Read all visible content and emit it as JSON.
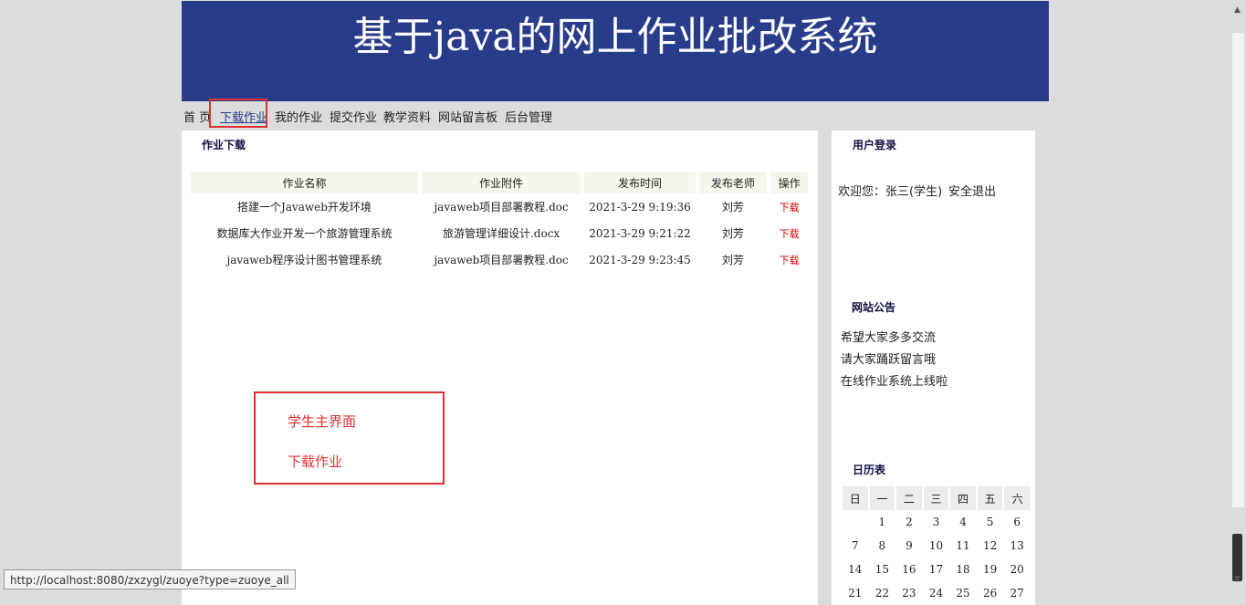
{
  "site": {
    "title": "基于java的网上作业批改系统"
  },
  "nav": {
    "items": [
      "首 页",
      "下载作业",
      "我的作业",
      "提交作业",
      "教学资料",
      "网站留言板",
      "后台管理"
    ],
    "active_index": 1
  },
  "main": {
    "section_title": "作业下载",
    "columns": [
      "作业名称",
      "作业附件",
      "发布时间",
      "发布老师",
      "操作"
    ],
    "rows": [
      {
        "name": "搭建一个Javaweb开发环境",
        "attachment": "javaweb项目部署教程.doc",
        "time": "2021-3-29 9:19:36",
        "teacher": "刘芳",
        "action": "下载"
      },
      {
        "name": "数据库大作业开发一个旅游管理系统",
        "attachment": "旅游管理详细设计.docx",
        "time": "2021-3-29 9:21:22",
        "teacher": "刘芳",
        "action": "下载"
      },
      {
        "name": "javaweb程序设计图书管理系统",
        "attachment": "javaweb项目部署教程.doc",
        "time": "2021-3-29 9:23:45",
        "teacher": "刘芳",
        "action": "下载"
      }
    ]
  },
  "annotation": {
    "line1": "学生主界面",
    "line2": "下载作业"
  },
  "sidebar": {
    "login": {
      "title": "用户登录",
      "welcome": "欢迎您：张三(学生)",
      "logout": "安全退出"
    },
    "notice": {
      "title": "网站公告",
      "items": [
        "希望大家多多交流",
        "请大家踊跃留言哦",
        "在线作业系统上线啦"
      ]
    },
    "calendar": {
      "title": "日历表",
      "weekdays": [
        "日",
        "一",
        "二",
        "三",
        "四",
        "五",
        "六"
      ],
      "weeks": [
        [
          "",
          "1",
          "2",
          "3",
          "4",
          "5",
          "6"
        ],
        [
          "7",
          "8",
          "9",
          "10",
          "11",
          "12",
          "13"
        ],
        [
          "14",
          "15",
          "16",
          "17",
          "18",
          "19",
          "20"
        ],
        [
          "21",
          "22",
          "23",
          "24",
          "25",
          "26",
          "27"
        ]
      ]
    }
  },
  "status_bar": {
    "url": "http://localhost:8080/zxzygl/zuoye?type=zuoye_all"
  },
  "colors": {
    "banner": "#293c8a",
    "highlight": "#e03131",
    "download_link": "#dd0000"
  }
}
